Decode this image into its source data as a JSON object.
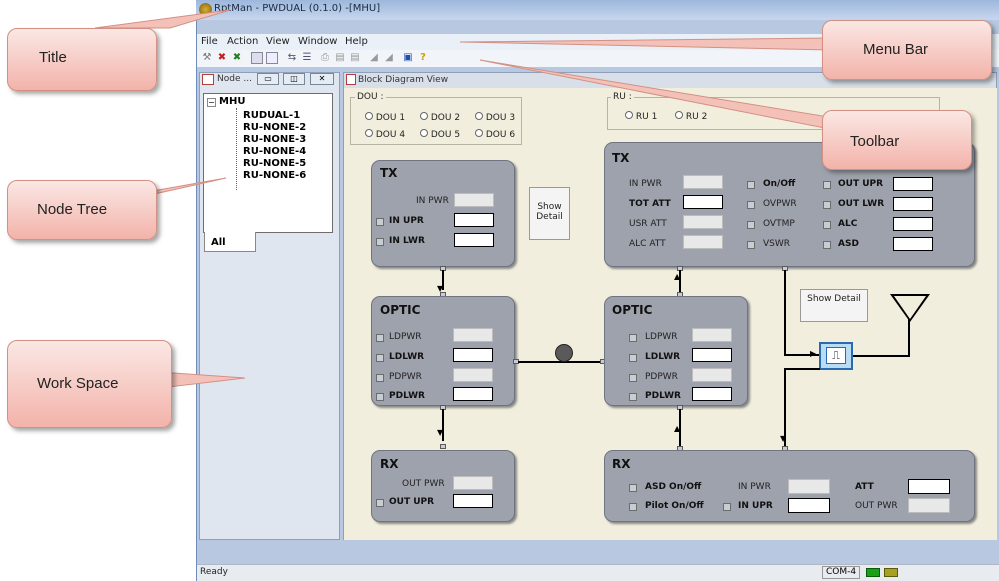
{
  "window": {
    "title": "RptMan - PWDUAL (0.1.0) -[MHU]"
  },
  "menu": {
    "items": [
      "File",
      "Action",
      "View",
      "Window",
      "Help"
    ]
  },
  "toolbar": {
    "icons": [
      "config-icon",
      "disconnect-icon",
      "reset-icon",
      "window-icon",
      "grid-icon",
      "link-icon",
      "list-icon",
      "print-icon",
      "chart-icon",
      "chart2-icon",
      "chart3-icon",
      "monitor-icon",
      "help-icon"
    ]
  },
  "node_panel": {
    "title": "Node ...",
    "root": "MHU",
    "children": [
      "RUDUAL-1",
      "RU-NONE-2",
      "RU-NONE-3",
      "RU-NONE-4",
      "RU-NONE-5",
      "RU-NONE-6"
    ],
    "tab": "All"
  },
  "block_diagram": {
    "title": "Block Diagram View",
    "dou_label": "DOU :",
    "dou_options": [
      "DOU 1",
      "DOU 2",
      "DOU 3",
      "DOU 4",
      "DOU 5",
      "DOU 6"
    ],
    "ru_label": "RU :",
    "ru_options": [
      "RU 1",
      "RU 2"
    ],
    "dou_tx": {
      "title": "TX",
      "in_pwr": "IN PWR",
      "in_upr": "IN UPR",
      "in_lwr": "IN LWR"
    },
    "show_detail_1": "Show Detail",
    "dou_optic": {
      "title": "OPTIC",
      "ldpwr": "LDPWR",
      "ldlwr": "LDLWR",
      "pdpwr": "PDPWR",
      "pdlwr": "PDLWR"
    },
    "dou_rx": {
      "title": "RX",
      "out_pwr": "OUT PWR",
      "out_upr": "OUT UPR"
    },
    "ru_tx": {
      "title": "TX",
      "in_pwr": "IN PWR",
      "tot_att": "TOT ATT",
      "usr_att": "USR ATT",
      "alc_att": "ALC ATT",
      "on_off": "On/Off",
      "ovpwr": "OVPWR",
      "ovtmp": "OVTMP",
      "vswr": "VSWR",
      "out_upr": "OUT UPR",
      "out_lwr": "OUT LWR",
      "alc": "ALC",
      "asd": "ASD"
    },
    "show_detail_2": "Show Detail",
    "ru_optic": {
      "title": "OPTIC",
      "ldpwr": "LDPWR",
      "ldlwr": "LDLWR",
      "pdpwr": "PDPWR",
      "pdlwr": "PDLWR"
    },
    "ru_rx": {
      "title": "RX",
      "asd_on_off": "ASD On/Off",
      "pilot_on_off": "Pilot On/Off",
      "in_pwr": "IN PWR",
      "in_upr": "IN UPR",
      "att": "ATT",
      "out_pwr": "OUT PWR"
    }
  },
  "status": {
    "left": "Ready",
    "port": "COM-4"
  },
  "callouts": {
    "title": "Title",
    "menu_bar": "Menu Bar",
    "toolbar": "Toolbar",
    "node_tree": "Node Tree",
    "work_space": "Work Space"
  }
}
